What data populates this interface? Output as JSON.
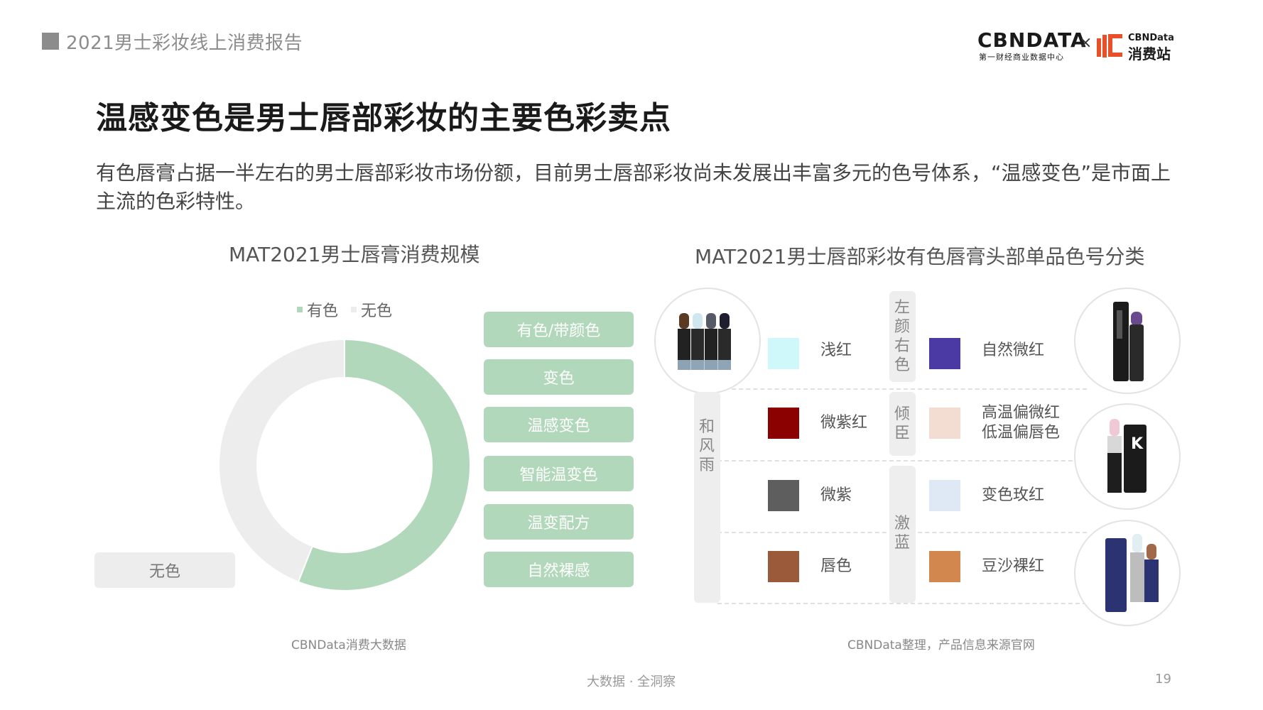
{
  "header": {
    "report_title": "2021男士彩妆线上消费报告"
  },
  "logo": {
    "cbn_text": "CBNDATA",
    "cbn_sub": "第一财经商业数据中心",
    "times": "×",
    "brand_en": "CBNData",
    "brand_cn": "消费站"
  },
  "page_title": "温感变色是男士唇部彩妆的主要色彩卖点",
  "subtitle": "有色唇膏占据一半左右的男士唇部彩妆市场份额，目前男士唇部彩妆尚未发展出丰富多元的色号体系，“温感变色”是市面上主流的色彩特性。",
  "chart_data": [
    {
      "type": "pie",
      "title": "MAT2021男士唇膏消费规模",
      "series": [
        {
          "name": "有色",
          "value": 56,
          "color": "#b2d8bb"
        },
        {
          "name": "无色",
          "value": 44,
          "color": "#ededed"
        }
      ],
      "legend": "top",
      "callout_labels": {
        "colorless": "无色"
      },
      "attribute_tags": [
        "有色/带颜色",
        "变色",
        "温感变色",
        "智能温变色",
        "温变配方",
        "自然裸感"
      ]
    },
    {
      "type": "table",
      "title": "MAT2021男士唇部彩妆有色唇膏头部单品色号分类",
      "groups": [
        {
          "name": "和风雨",
          "colors": [
            {
              "name": "浅红",
              "hex": "#cff8fb"
            },
            {
              "name": "微紫红",
              "hex": "#8b0000"
            },
            {
              "name": "微紫",
              "hex": "#5e5e5e"
            },
            {
              "name": "唇色",
              "hex": "#9b5a3a"
            }
          ]
        },
        {
          "name": "左颜右色",
          "colors": [
            {
              "name": "自然微红",
              "hex": "#4b3aa3"
            }
          ]
        },
        {
          "name": "倾臣",
          "colors": [
            {
              "name": "高温偏微红",
              "name2": "低温偏唇色",
              "hex": "#f3ddd2"
            }
          ]
        },
        {
          "name": "激蓝",
          "colors": [
            {
              "name": "变色玫红",
              "hex": "#dee9f5"
            },
            {
              "name": "豆沙裸红",
              "hex": "#d2874f"
            }
          ]
        }
      ]
    }
  ],
  "sources": {
    "left": "CBNData消费大数据",
    "right": "CBNData整理，产品信息来源官网"
  },
  "footer": {
    "slogan": "大数据 · 全洞察",
    "page": "19"
  }
}
